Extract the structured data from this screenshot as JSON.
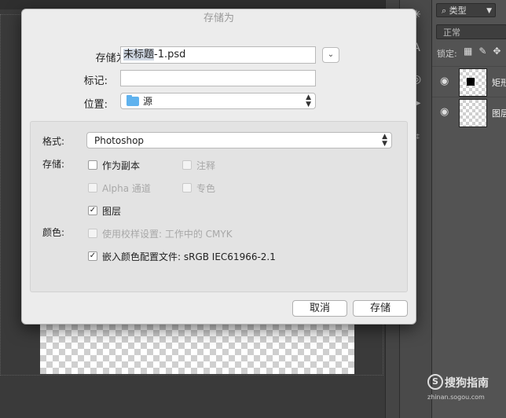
{
  "dialog": {
    "title": "存储为",
    "save_as_label": "存储为:",
    "filename_base": "未标题",
    "filename_rest": "-1.psd",
    "tags_label": "标记:",
    "tags_value": "",
    "location_label": "位置:",
    "location_value": "源",
    "format_label": "格式:",
    "format_value": "Photoshop",
    "storage_label": "存储:",
    "color_label": "颜色:",
    "options": {
      "copy": {
        "label": "作为副本",
        "checked": false,
        "enabled": true
      },
      "notes": {
        "label": "注释",
        "checked": false,
        "enabled": false
      },
      "alpha": {
        "label": "Alpha 通道",
        "checked": false,
        "enabled": false
      },
      "spot": {
        "label": "专色",
        "checked": false,
        "enabled": false
      },
      "layers": {
        "label": "图层",
        "checked": true,
        "enabled": true
      },
      "proof": {
        "label": "使用校样设置: 工作中的 CMYK",
        "checked": false,
        "enabled": false
      },
      "icc": {
        "label": "嵌入颜色配置文件: sRGB IEC61966-2.1",
        "checked": true,
        "enabled": true
      }
    },
    "cancel_label": "取消",
    "save_label": "存储"
  },
  "layers_panel": {
    "filter_label": "类型",
    "blend_mode": "正常",
    "lock_label": "锁定:",
    "layers": [
      {
        "name": "矩形"
      },
      {
        "name": "图层"
      }
    ]
  },
  "watermark": {
    "text": "搜狗指南",
    "subtext": "zhinan.sogou.com"
  }
}
